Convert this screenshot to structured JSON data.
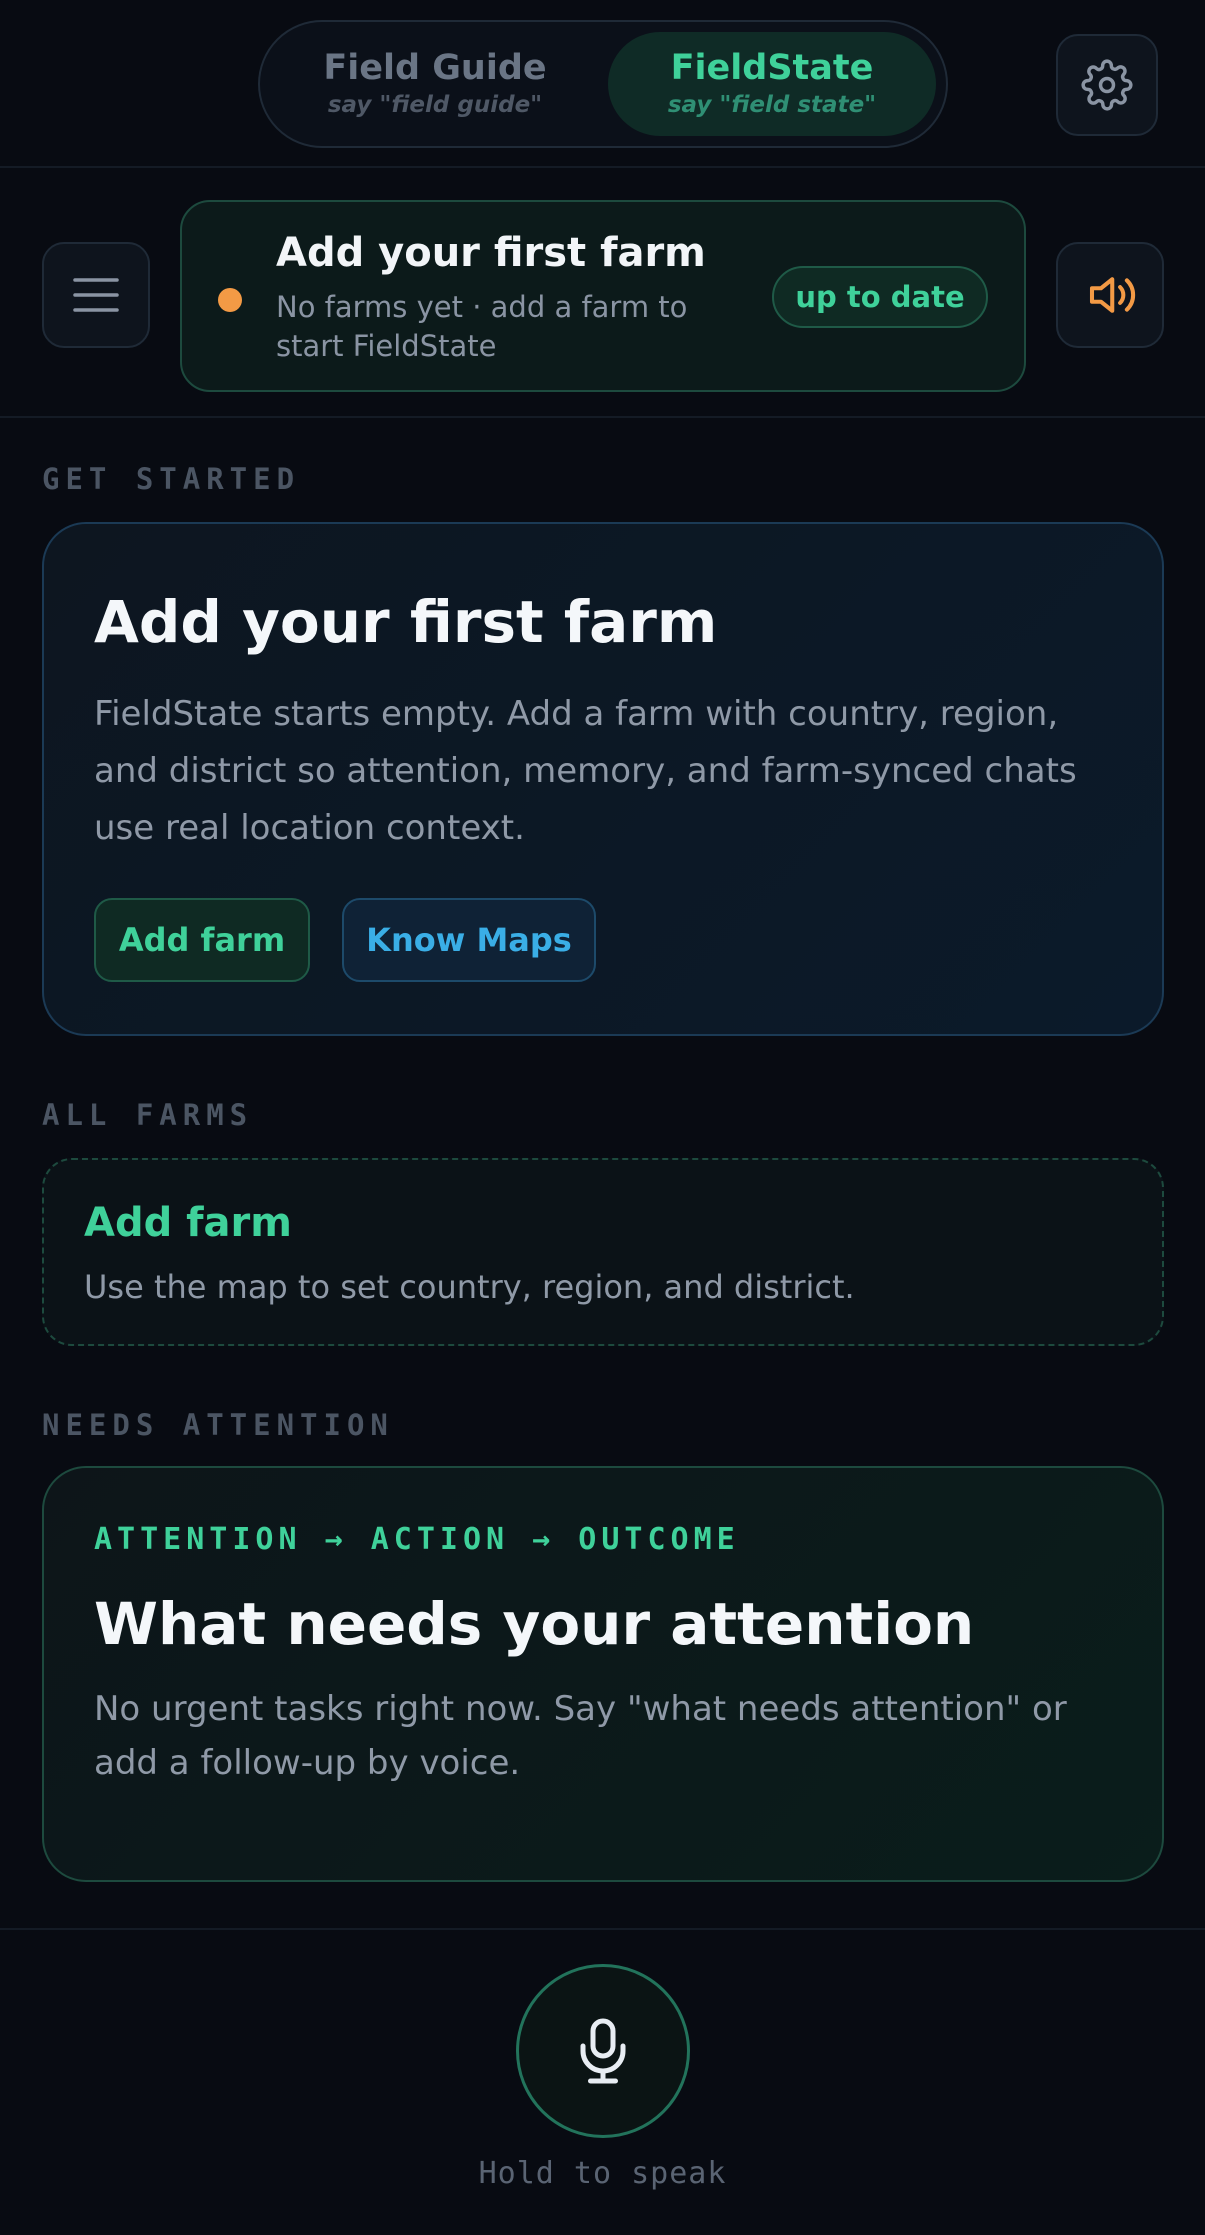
{
  "mode_switch": {
    "field_guide": {
      "title": "Field Guide",
      "hint": "say \"field guide\""
    },
    "field_state": {
      "title": "FieldState",
      "hint": "say \"field state\""
    }
  },
  "status": {
    "title": "Add your first farm",
    "subtitle": "No farms yet · add a farm to start FieldState",
    "pill": "up to date",
    "dot_color": "#f39a45"
  },
  "get_started": {
    "label": "GET STARTED",
    "title": "Add your first farm",
    "body": "FieldState starts empty. Add a farm with country, region, and district so attention, memory, and farm-synced chats use real location context.",
    "add_farm_button": "Add farm",
    "know_maps_button": "Know Maps"
  },
  "all_farms": {
    "label": "ALL FARMS",
    "add_title": "Add farm",
    "add_subtitle": "Use the map to set country, region, and district."
  },
  "needs_attention": {
    "label": "NEEDS ATTENTION",
    "kicker": "ATTENTION → ACTION → OUTCOME",
    "title": "What needs your attention",
    "body": "No urgent tasks right now. Say \"what needs attention\" or add a follow-up by voice."
  },
  "voice": {
    "label": "Hold to speak"
  },
  "icons": {
    "settings": "gear-icon",
    "menu": "hamburger-menu-icon",
    "speaker": "speaker-volume-icon",
    "mic": "microphone-icon"
  },
  "colors": {
    "accent_green": "#3fd19a",
    "accent_blue": "#3aaee6",
    "status_orange": "#f39a45",
    "background": "#080b12"
  }
}
